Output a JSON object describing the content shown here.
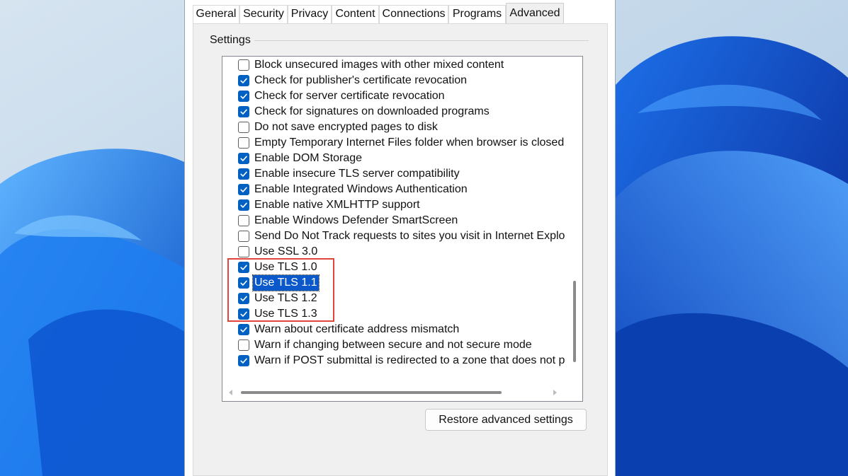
{
  "tabs": [
    {
      "label": "General"
    },
    {
      "label": "Security"
    },
    {
      "label": "Privacy"
    },
    {
      "label": "Content"
    },
    {
      "label": "Connections"
    },
    {
      "label": "Programs"
    },
    {
      "label": "Advanced",
      "active": true
    }
  ],
  "settings_group_label": "Settings",
  "settings_items": [
    {
      "label": "Block unsecured images with other mixed content",
      "checked": false
    },
    {
      "label": "Check for publisher's certificate revocation",
      "checked": true
    },
    {
      "label": "Check for server certificate revocation",
      "checked": true
    },
    {
      "label": "Check for signatures on downloaded programs",
      "checked": true
    },
    {
      "label": "Do not save encrypted pages to disk",
      "checked": false
    },
    {
      "label": "Empty Temporary Internet Files folder when browser is closed",
      "checked": false
    },
    {
      "label": "Enable DOM Storage",
      "checked": true
    },
    {
      "label": "Enable insecure TLS server compatibility",
      "checked": true
    },
    {
      "label": "Enable Integrated Windows Authentication",
      "checked": true
    },
    {
      "label": "Enable native XMLHTTP support",
      "checked": true
    },
    {
      "label": "Enable Windows Defender SmartScreen",
      "checked": false
    },
    {
      "label": "Send Do Not Track requests to sites you visit in Internet Explo",
      "checked": false
    },
    {
      "label": "Use SSL 3.0",
      "checked": false
    },
    {
      "label": "Use TLS 1.0",
      "checked": true
    },
    {
      "label": "Use TLS 1.1",
      "checked": true,
      "selected": true
    },
    {
      "label": "Use TLS 1.2",
      "checked": true
    },
    {
      "label": "Use TLS 1.3",
      "checked": true
    },
    {
      "label": "Warn about certificate address mismatch",
      "checked": true
    },
    {
      "label": "Warn if changing between secure and not secure mode",
      "checked": false
    },
    {
      "label": "Warn if POST submittal is redirected to a zone that does not p",
      "checked": true
    }
  ],
  "restore_button_label": "Restore advanced settings",
  "colors": {
    "accent": "#0061c2",
    "selection": "#0a58c9",
    "annotation": "#e0443a",
    "wallpaper_base": "#c9dcec",
    "wallpaper_bloom": "#0a5fd6"
  },
  "icons": {
    "checkbox": "checkmark-icon",
    "scroll_left": "scroll-left-arrow-icon",
    "scroll_right": "scroll-right-arrow-icon"
  }
}
